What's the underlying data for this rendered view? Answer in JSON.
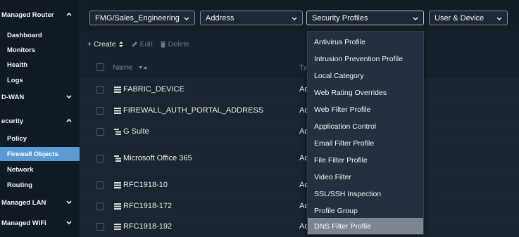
{
  "sidebar": {
    "items": [
      {
        "label": "Managed Router",
        "kind": "section",
        "chevron": "up"
      },
      {
        "label": "Dashboard",
        "kind": "item"
      },
      {
        "label": "Monitors",
        "kind": "item"
      },
      {
        "label": "Health",
        "kind": "item"
      },
      {
        "label": "Logs",
        "kind": "item"
      },
      {
        "label": "D-WAN",
        "kind": "section",
        "chevron": "down"
      },
      {
        "label": "ecurity",
        "kind": "section",
        "chevron": "up"
      },
      {
        "label": "Policy",
        "kind": "item"
      },
      {
        "label": "Firewall Objects",
        "kind": "item",
        "active": true
      },
      {
        "label": "Network",
        "kind": "item"
      },
      {
        "label": "Routing",
        "kind": "item"
      },
      {
        "label": "Managed LAN",
        "kind": "section",
        "chevron": "down"
      },
      {
        "label": "Managed WiFi",
        "kind": "section",
        "chevron": "down"
      }
    ]
  },
  "filters": {
    "device": "FMG/Sales_Engineering",
    "category": "Address",
    "profiles": "Security Profiles",
    "user_device": "User & Device"
  },
  "toolbar": {
    "create": "+ Create",
    "edit": "Edit",
    "delete": "Delete"
  },
  "table": {
    "header_name": "Name",
    "header_type": "Ty",
    "rows": [
      {
        "name": "FABRIC_DEVICE",
        "type": "Ad",
        "icon": "address-icon"
      },
      {
        "name": "FIREWALL_AUTH_PORTAL_ADDRESS",
        "type": "Ad",
        "icon": "address-icon"
      },
      {
        "name": "G Suite",
        "type": "Ad",
        "icon": "address-group-icon"
      },
      {
        "name": "Microsoft Office 365",
        "type": "Ad",
        "icon": "address-group-icon"
      },
      {
        "name": "RFC1918-10",
        "type": "Ad",
        "icon": "address-icon"
      },
      {
        "name": "RFC1918-172",
        "type": "Ad",
        "icon": "address-icon"
      },
      {
        "name": "RFC1918-192",
        "type": "Ad",
        "icon": "address-icon"
      }
    ]
  },
  "menu": {
    "items": [
      "Antivirus Profile",
      "Intrusion Prevention Profile",
      "Local Category",
      "Web Rating Overrides",
      "Web Filter Profile",
      "Application Control",
      "Email Filter Profile",
      "File Filter Profile",
      "Video Filter",
      "SSL/SSH Inspection",
      "Profile Group",
      "DNS Filter Profile"
    ],
    "highlighted": "DNS Filter Profile"
  },
  "colors": {
    "active_sidebar": "#5b9bd5",
    "menu_highlight": "#7d8590",
    "background": "#16212d"
  }
}
